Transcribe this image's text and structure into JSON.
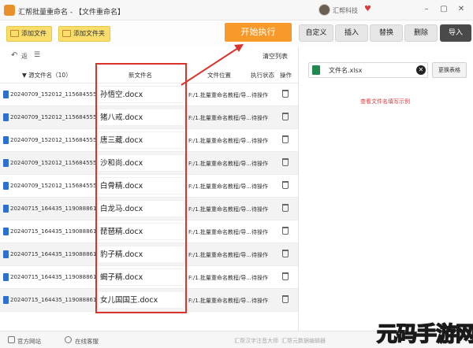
{
  "titlebar": {
    "app_title": "汇帮批量重命名 - 【文件重命名】",
    "brand_name": "汇帮科技",
    "minimize": "–",
    "restore": "▢",
    "close": "✕"
  },
  "toolbar": {
    "add_files": "添加文件",
    "add_folder": "添加文件夹",
    "start": "开始执行",
    "custom": "自定义",
    "insert": "插入",
    "replace": "替换",
    "delete": "删除",
    "import": "导入"
  },
  "list_tools": {
    "back": "返",
    "clear_list": "清空列表"
  },
  "table": {
    "columns": [
      "源文件名（10）",
      "新文件名",
      "文件位置",
      "执行状态",
      "操作"
    ],
    "rows": [
      {
        "orig": "20240709_152012_115684555",
        "new": "孙悟空.docx",
        "loc": "F:/1.批量重命名教程/导...",
        "status": "待操作"
      },
      {
        "orig": "20240709_152012_115684555",
        "new": "猪八戒.docx",
        "loc": "F:/1.批量重命名教程/导...",
        "status": "待操作"
      },
      {
        "orig": "20240709_152012_115684555",
        "new": "唐三藏.docx",
        "loc": "F:/1.批量重命名教程/导...",
        "status": "待操作"
      },
      {
        "orig": "20240709_152012_115684555",
        "new": "沙和尚.docx",
        "loc": "F:/1.批量重命名教程/导...",
        "status": "待操作"
      },
      {
        "orig": "20240709_152012_115684555",
        "new": "白骨精.docx",
        "loc": "F:/1.批量重命名教程/导...",
        "status": "待操作"
      },
      {
        "orig": "20240715_164435_119088861",
        "new": "白龙马.docx",
        "loc": "F:/1.批量重命名教程/导...",
        "status": "待操作"
      },
      {
        "orig": "20240715_164435_119088861",
        "new": "琵琶精.docx",
        "loc": "F:/1.批量重命名教程/导...",
        "status": "待操作"
      },
      {
        "orig": "20240715_164435_119088861",
        "new": "豹子精.docx",
        "loc": "F:/1.批量重命名教程/导...",
        "status": "待操作"
      },
      {
        "orig": "20240715_164435_119088861",
        "new": "蝎子精.docx",
        "loc": "F:/1.批量重命名教程/导...",
        "status": "待操作"
      },
      {
        "orig": "20240715_164435_119088861",
        "new": "女儿国国王.docx",
        "loc": "F:/1.批量重命名教程/导...",
        "status": "待操作"
      }
    ]
  },
  "right_panel": {
    "excel_file": "文件名.xlsx",
    "change_table": "更换表格",
    "example_link": "查看文件名填写示例"
  },
  "footer": {
    "official_site": "官方网站",
    "online_support": "在线客服",
    "faint_1": "汇帮汉字注音大师",
    "faint_2": "汇帮元数据编辑器"
  },
  "watermark": {
    "text": "元码手游网"
  },
  "colors": {
    "accent_orange": "#f79a2a",
    "button_yellow": "#fbdd6b",
    "highlight_red": "#d9342b",
    "link_red": "#e03a3a"
  }
}
